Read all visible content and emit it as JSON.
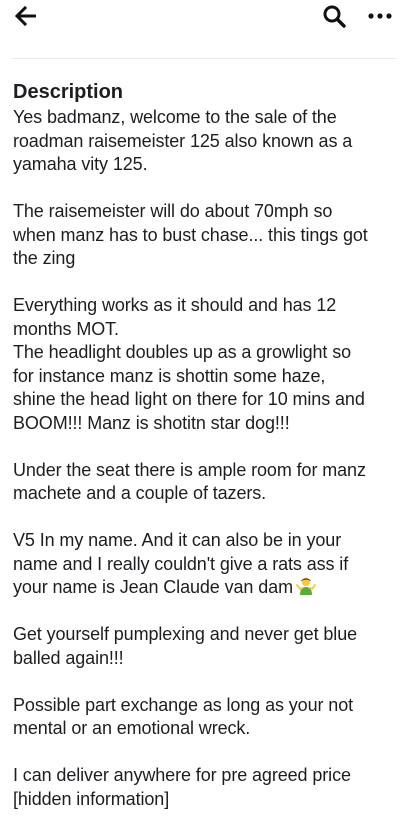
{
  "header": {
    "back_icon": "arrow-left-icon",
    "search_icon": "search-icon",
    "more_icon": "more-horizontal-icon"
  },
  "description": {
    "heading": "Description",
    "paragraphs": [
      [
        "Yes badmanz, welcome to the sale of the",
        "roadman raisemeister 125 also known as a",
        "yamaha vity 125."
      ],
      [
        "The raisemeister will do about 70mph so",
        "when manz has to bust chase... this tings got",
        "the zing"
      ],
      [
        "Everything works as it should and has 12",
        "months MOT.",
        "The headlight doubles up as a growlight so",
        "for instance  manz is shottin  some haze,",
        "shine the head light on there for 10 mins and",
        "BOOM!!! Manz is shotitn star dog!!!"
      ],
      [
        "Under the seat there is ample room for manz",
        "machete and a couple of tazers."
      ],
      [
        "V5 In my name. And it can also be in your",
        "name and I really couldn't give a rats ass if",
        "your name is Jean Claude van dam"
      ],
      [
        "Get yourself pumplexing and never get blue",
        "balled again!!!"
      ],
      [
        "Possible part exchange as long as your not",
        "mental or an emotional wreck."
      ],
      [
        "I can deliver anywhere for pre agreed price",
        "[hidden information]"
      ]
    ],
    "emoji_icon": "person-shrugging-emoji-icon"
  }
}
